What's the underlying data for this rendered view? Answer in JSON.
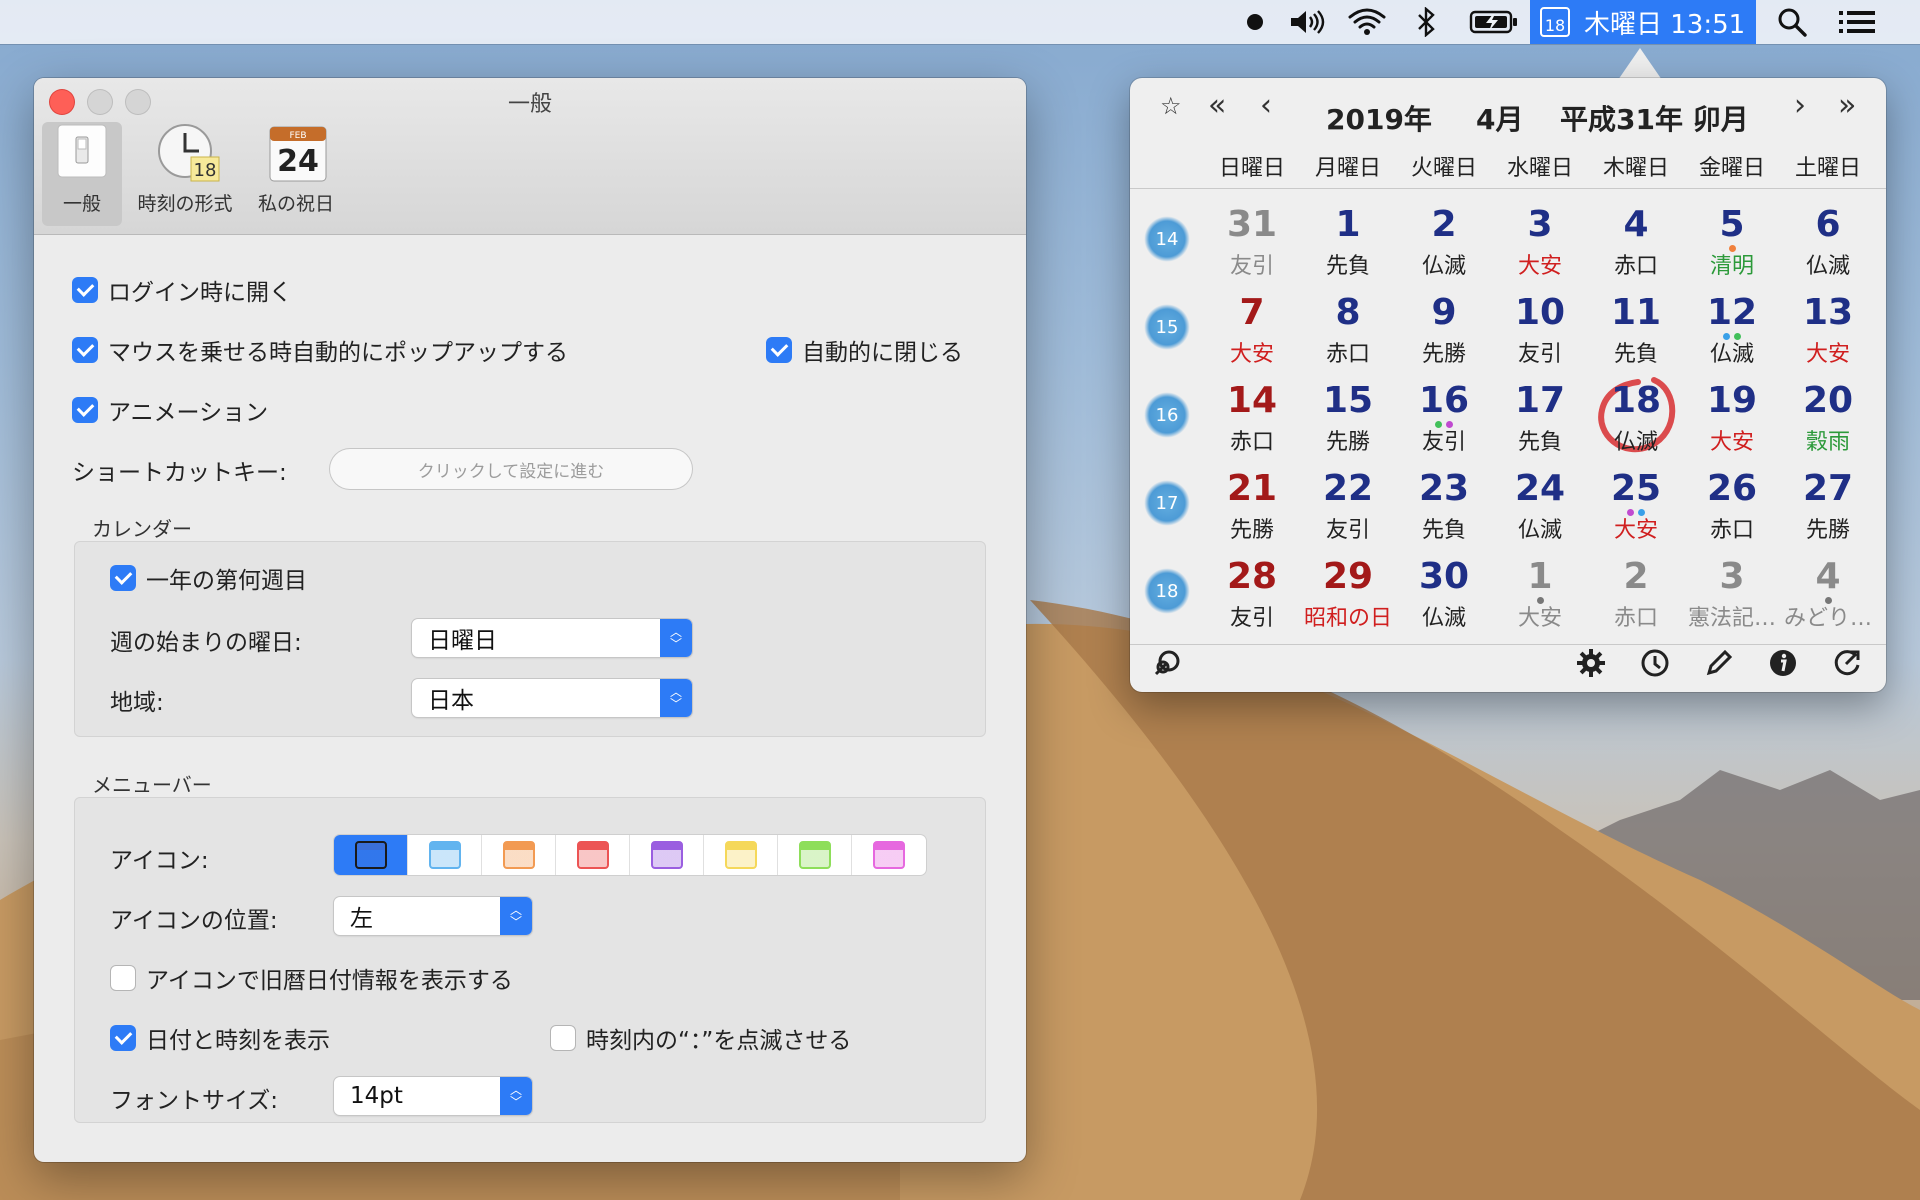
{
  "menubar": {
    "icons": [
      "record-dot-icon",
      "volume-icon",
      "wifi-icon",
      "bluetooth-icon",
      "battery-icon"
    ],
    "clock_icon_day": "18",
    "clock_text": "木曜日 13:51",
    "right_icons": [
      "search-icon",
      "list-icon"
    ]
  },
  "window": {
    "title": "一般",
    "tabs": [
      {
        "label": "一般",
        "selected": true
      },
      {
        "label": "時刻の形式",
        "badge": "18"
      },
      {
        "label": "私の祝日",
        "month": "FEB",
        "day": "24"
      }
    ],
    "general": {
      "open_at_login": "ログイン時に開く",
      "popup_on_hover": "マウスを乗せる時自動的にポップアップする",
      "auto_close": "自動的に閉じる",
      "animation": "アニメーション",
      "shortcut_label": "ショートカットキー:",
      "shortcut_placeholder": "クリックして設定に進む"
    },
    "calendar_group": {
      "title": "カレンダー",
      "week_number": "一年の第何週目",
      "week_start_label": "週の始まりの曜日:",
      "week_start_value": "日曜日",
      "region_label": "地域:",
      "region_value": "日本"
    },
    "menubar_group": {
      "title": "メニューバー",
      "icon_label": "アイコン:",
      "icon_colors": [
        "#3a6fd8",
        "#62b4ef",
        "#f29a52",
        "#ec5454",
        "#9a5ee0",
        "#f5d85a",
        "#8ede5a",
        "#e668df"
      ],
      "icon_position_label": "アイコンの位置:",
      "icon_position_value": "左",
      "show_lunar": "アイコンで旧暦日付情報を表示する",
      "show_datetime": "日付と時刻を表示",
      "blink_colon": "時刻内の“：”を点滅させる",
      "font_size_label": "フォントサイズ:",
      "font_size_value": "14pt"
    }
  },
  "calendar": {
    "year": "2019年",
    "month": "4月",
    "era": "平成31年 卯月",
    "nav": {
      "star": "☆",
      "prev_year": "«",
      "prev_month": "‹",
      "next_month": "›",
      "next_year": "»"
    },
    "weekdays": [
      "日曜日",
      "月曜日",
      "火曜日",
      "水曜日",
      "木曜日",
      "金曜日",
      "土曜日"
    ],
    "weeks": [
      {
        "num": "14",
        "days": [
          {
            "d": "31",
            "s": "友引",
            "kind": "other"
          },
          {
            "d": "1",
            "s": "先負"
          },
          {
            "d": "2",
            "s": "仏滅"
          },
          {
            "d": "3",
            "s": "大安",
            "sub_color": "red"
          },
          {
            "d": "4",
            "s": "赤口"
          },
          {
            "d": "5",
            "s": "清明",
            "sub_color": "green",
            "dots": [
              "#f0803c"
            ]
          },
          {
            "d": "6",
            "s": "仏滅"
          }
        ]
      },
      {
        "num": "15",
        "days": [
          {
            "d": "7",
            "s": "大安",
            "kind": "sun",
            "sub_color": "red"
          },
          {
            "d": "8",
            "s": "赤口"
          },
          {
            "d": "9",
            "s": "先勝"
          },
          {
            "d": "10",
            "s": "友引"
          },
          {
            "d": "11",
            "s": "先負"
          },
          {
            "d": "12",
            "s": "仏滅",
            "dots": [
              "#3aa0e8",
              "#42c05a"
            ]
          },
          {
            "d": "13",
            "s": "大安",
            "kind": "sat",
            "sub_color": "red"
          }
        ]
      },
      {
        "num": "16",
        "days": [
          {
            "d": "14",
            "s": "赤口",
            "kind": "sun"
          },
          {
            "d": "15",
            "s": "先勝"
          },
          {
            "d": "16",
            "s": "友引",
            "dots": [
              "#42c05a",
              "#c04ad0"
            ]
          },
          {
            "d": "17",
            "s": "先負"
          },
          {
            "d": "18",
            "s": "仏滅",
            "today": true
          },
          {
            "d": "19",
            "s": "大安",
            "sub_color": "red"
          },
          {
            "d": "20",
            "s": "穀雨",
            "sub_color": "green"
          }
        ]
      },
      {
        "num": "17",
        "days": [
          {
            "d": "21",
            "s": "先勝",
            "kind": "sun"
          },
          {
            "d": "22",
            "s": "友引"
          },
          {
            "d": "23",
            "s": "先負"
          },
          {
            "d": "24",
            "s": "仏滅"
          },
          {
            "d": "25",
            "s": "大安",
            "sub_color": "red",
            "dots": [
              "#c04ad0",
              "#3aa0e8"
            ]
          },
          {
            "d": "26",
            "s": "赤口"
          },
          {
            "d": "27",
            "s": "先勝"
          }
        ]
      },
      {
        "num": "18",
        "days": [
          {
            "d": "28",
            "s": "友引",
            "kind": "sun"
          },
          {
            "d": "29",
            "s": "昭和の日",
            "kind": "holiday",
            "sub_color": "red"
          },
          {
            "d": "30",
            "s": "仏滅"
          },
          {
            "d": "1",
            "s": "大安",
            "kind": "other",
            "dots": [
              "#777777"
            ]
          },
          {
            "d": "2",
            "s": "赤口",
            "kind": "other"
          },
          {
            "d": "3",
            "s": "憲法記…",
            "kind": "other"
          },
          {
            "d": "4",
            "s": "みどり…",
            "kind": "other",
            "dots": [
              "#777777"
            ]
          }
        ]
      }
    ],
    "footer_icons": [
      "link-icon",
      "gear-icon",
      "clock-icon",
      "pencil-icon",
      "info-icon",
      "refresh-icon"
    ]
  }
}
